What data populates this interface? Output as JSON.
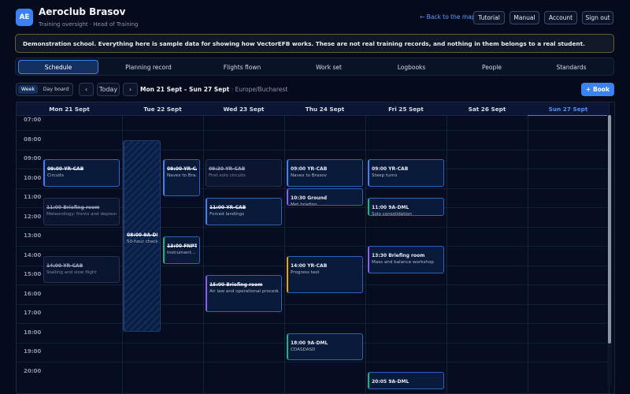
{
  "header": {
    "logo_initials": "AE",
    "club_name": "Aeroclub Brasov",
    "subtitle": "Training oversight · Head of Training",
    "back_link": "← Back to the map",
    "buttons": [
      "Tutorial",
      "Manual",
      "Account",
      "Sign out"
    ]
  },
  "notice": "Demonstration school. Everything here is sample data for showing how VectorEFB works. These are not real training records, and nothing in them belongs to a real student.",
  "tabs": [
    "Schedule",
    "Planning record",
    "Flights flown",
    "Work set",
    "Logbooks",
    "People",
    "Standards"
  ],
  "toolbar": {
    "view_week": "Week",
    "view_day": "Day board",
    "prev": "‹",
    "today": "Today",
    "next": "›",
    "range": "Mon 21 Sept – Sun 27 Sept",
    "timezone": "· Europe/Bucharest",
    "book": "+ Book"
  },
  "calendar": {
    "days": [
      "Mon 21 Sept",
      "Tue 22 Sept",
      "Wed 23 Sept",
      "Thu 24 Sept",
      "Fri 25 Sept",
      "Sat 26 Sept",
      "Sun 27 Sept"
    ],
    "today_index": 6,
    "hours": [
      "07:00",
      "08:00",
      "09:00",
      "10:00",
      "11:00",
      "12:00",
      "13:00",
      "14:00",
      "15:00",
      "16:00",
      "17:00",
      "18:00",
      "19:00",
      "20:00"
    ],
    "events": [
      {
        "day": 0,
        "start": 9.0,
        "end": 10.5,
        "time": "09:00",
        "title": "YR-CAB",
        "desc": "Circuits",
        "style": "blue"
      },
      {
        "day": 0,
        "start": 11.0,
        "end": 12.5,
        "time": "11:00",
        "title": "Briefing room",
        "desc": "Meteorology: fronts and depress…",
        "style": "dim"
      },
      {
        "day": 0,
        "start": 14.0,
        "end": 15.5,
        "time": "14:00",
        "title": "YR-CAB",
        "desc": "Stalling and slow flight",
        "style": "dim"
      },
      {
        "day": 1,
        "start": 8.0,
        "end": 18.0,
        "time": "08:00",
        "title": "9A-DML",
        "desc": "50-hour check",
        "style": "hatched"
      },
      {
        "day": 1,
        "start": 9.0,
        "end": 11.0,
        "time": "09:00",
        "title": "YR-CAB",
        "desc": "Navex to Bra…",
        "style": "blue"
      },
      {
        "day": 1,
        "start": 13.0,
        "end": 14.5,
        "time": "13:00",
        "title": "FNPT II",
        "desc": "Instrument…",
        "style": "teal"
      },
      {
        "day": 2,
        "start": 9.0,
        "end": 10.5,
        "time": "09:30",
        "title": "YR-CAB",
        "desc": "First solo circuits",
        "style": "dim"
      },
      {
        "day": 2,
        "start": 11.0,
        "end": 12.5,
        "time": "11:00",
        "title": "YR-CAB",
        "desc": "Forced landings",
        "style": "blue"
      },
      {
        "day": 2,
        "start": 15.0,
        "end": 17.0,
        "time": "15:00",
        "title": "Briefing room",
        "desc": "Air law and operational procedur…",
        "style": "purple"
      },
      {
        "day": 3,
        "start": 9.0,
        "end": 10.5,
        "time": "09:00",
        "title": "YR-CAB",
        "desc": "Navex to Brasov",
        "style": "blue"
      },
      {
        "day": 3,
        "start": 10.5,
        "end": 11.5,
        "time": "10:30",
        "title": "Ground",
        "desc": "Met briefing",
        "style": "purple"
      },
      {
        "day": 3,
        "start": 14.0,
        "end": 16.0,
        "time": "14:00",
        "title": "YR-CAB",
        "desc": "Progress test",
        "style": "orange"
      },
      {
        "day": 3,
        "start": 18.0,
        "end": 19.5,
        "time": "18:00",
        "title": "9A-DML",
        "desc": "CDASDASD",
        "style": "teal"
      },
      {
        "day": 4,
        "start": 9.0,
        "end": 10.5,
        "time": "09:00",
        "title": "YR-CAB",
        "desc": "Steep turns",
        "style": "blue"
      },
      {
        "day": 4,
        "start": 11.0,
        "end": 12.0,
        "time": "11:00",
        "title": "9A-DML",
        "desc": "Solo consolidation",
        "style": "teal"
      },
      {
        "day": 4,
        "start": 13.5,
        "end": 15.0,
        "time": "13:30",
        "title": "Briefing room",
        "desc": "Mass and balance workshop",
        "style": "purple"
      },
      {
        "day": 4,
        "start": 20.0,
        "end": 21.0,
        "time": "20:05",
        "title": "9A-DML",
        "desc": "",
        "style": "teal"
      }
    ]
  }
}
